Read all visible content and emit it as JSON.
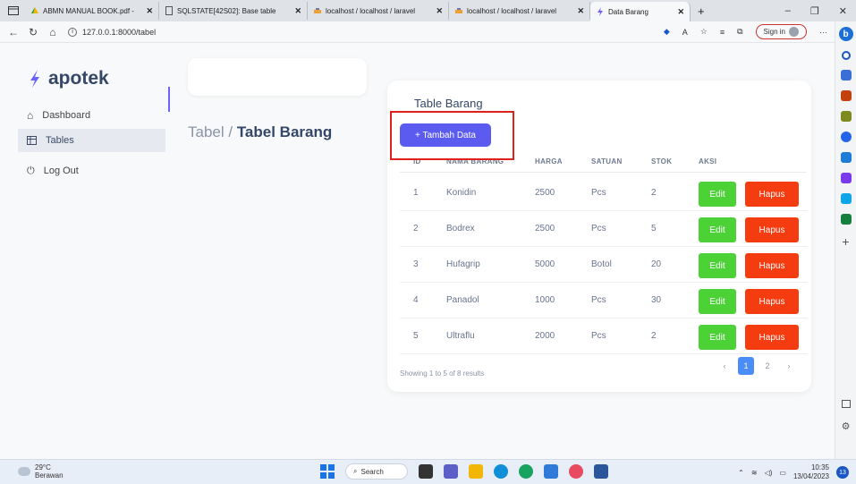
{
  "browser": {
    "tabs": [
      {
        "title": "ABMN MANUAL BOOK.pdf - ",
        "icon": "pdf-drive-icon"
      },
      {
        "title": "SQLSTATE[42S02]: Base table",
        "icon": "page-icon"
      },
      {
        "title": "localhost / localhost / laravel",
        "icon": "phpmyadmin-icon"
      },
      {
        "title": "localhost / localhost / laravel",
        "icon": "phpmyadmin-icon"
      },
      {
        "title": "Data Barang",
        "icon": "laravel-icon"
      }
    ],
    "url": "127.0.0.1:8000/tabel",
    "signin_label": "Sign in"
  },
  "app": {
    "brand": "apotek",
    "menu": [
      {
        "label": "Dashboard",
        "icon": "home-icon"
      },
      {
        "label": "Tables",
        "icon": "table-icon"
      },
      {
        "label": "Log Out",
        "icon": "power-icon"
      }
    ]
  },
  "breadcrumb": {
    "parent": "Tabel / ",
    "current": "Tabel Barang"
  },
  "table": {
    "title": "Table Barang",
    "add_button": "+ Tambah Data",
    "headers": [
      "ID",
      "NAMA BARANG",
      "HARGA",
      "SATUAN",
      "STOK",
      "AKSI"
    ],
    "rows": [
      {
        "id": "1",
        "nama": "Konidin",
        "harga": "2500",
        "satuan": "Pcs",
        "stok": "2"
      },
      {
        "id": "2",
        "nama": "Bodrex",
        "harga": "2500",
        "satuan": "Pcs",
        "stok": "5"
      },
      {
        "id": "3",
        "nama": "Hufagrip",
        "harga": "5000",
        "satuan": "Botol",
        "stok": "20"
      },
      {
        "id": "4",
        "nama": "Panadol",
        "harga": "1000",
        "satuan": "Pcs",
        "stok": "30"
      },
      {
        "id": "5",
        "nama": "Ultraflu",
        "harga": "2000",
        "satuan": "Pcs",
        "stok": "2"
      }
    ],
    "edit_label": "Edit",
    "delete_label": "Hapus",
    "showing": "Showing 1 to 5 of 8 results",
    "pages": [
      "‹",
      "1",
      "2",
      "›"
    ],
    "current_page": "1"
  },
  "taskbar": {
    "temp": "29°C",
    "weather": "Berawan",
    "search": "Search",
    "time": "10:35",
    "date": "13/04/2023",
    "notifications": "13"
  },
  "colors": {
    "primary": "#5b5bf0",
    "edit": "#4cd137",
    "delete": "#f53b10",
    "highlight": "#e0201a"
  }
}
